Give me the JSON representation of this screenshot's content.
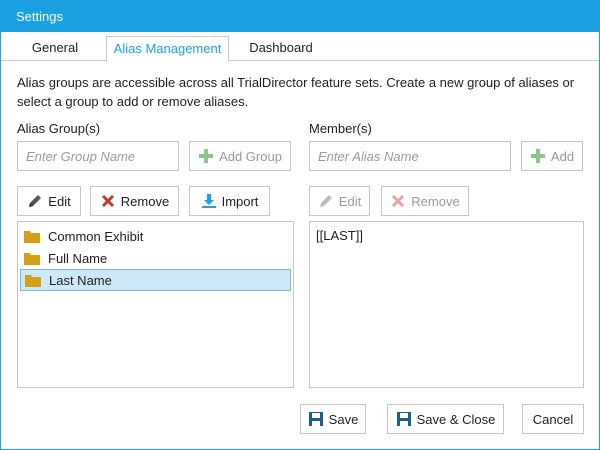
{
  "window": {
    "title": "Settings"
  },
  "tabs": [
    {
      "label": "General"
    },
    {
      "label": "Alias Management"
    },
    {
      "label": "Dashboard"
    }
  ],
  "description": "Alias groups are accessible across all TrialDirector feature sets. Create a new group of aliases or select a group to add or remove aliases.",
  "groups": {
    "label": "Alias Group(s)",
    "placeholder": "Enter Group Name",
    "add_label": "Add Group",
    "edit_label": "Edit",
    "remove_label": "Remove",
    "import_label": "Import",
    "items": [
      {
        "label": "Common Exhibit"
      },
      {
        "label": "Full Name"
      },
      {
        "label": "Last Name"
      }
    ],
    "selected_index": 2
  },
  "members": {
    "label": "Member(s)",
    "placeholder": "Enter Alias Name",
    "add_label": "Add",
    "edit_label": "Edit",
    "remove_label": "Remove",
    "items": [
      {
        "label": "[[LAST]]"
      }
    ]
  },
  "footer": {
    "save_label": "Save",
    "save_close_label": "Save & Close",
    "cancel_label": "Cancel"
  },
  "colors": {
    "accent": "#1ba1e2",
    "folder": "#d4a017",
    "add_green": "#8cc88c",
    "remove_red": "#c0392b"
  }
}
